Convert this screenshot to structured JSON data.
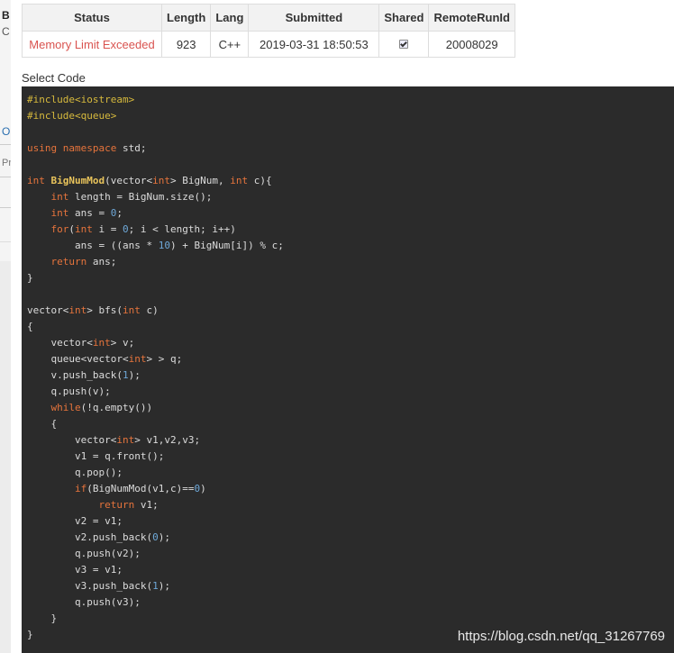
{
  "sidebar_fragments": [
    "B",
    "C",
    "O",
    "Pr"
  ],
  "table": {
    "headers": [
      "Status",
      "Length",
      "Lang",
      "Submitted",
      "Shared",
      "RemoteRunId"
    ],
    "row": {
      "status": "Memory Limit Exceeded",
      "length": "923",
      "lang": "C++",
      "submitted": "2019-03-31 18:50:53",
      "shared": true,
      "remote_run_id": "20008029"
    }
  },
  "select_code_label": "Select Code",
  "code_lines": [
    "#include<iostream>",
    "#include<queue>",
    "",
    "using namespace std;",
    "",
    "int BigNumMod(vector<int> BigNum, int c){",
    "    int length = BigNum.size();",
    "    int ans = 0;",
    "    for(int i = 0; i < length; i++)",
    "        ans = ((ans * 10) + BigNum[i]) % c;",
    "    return ans;",
    "}",
    "",
    "vector<int> bfs(int c)",
    "{",
    "    vector<int> v;",
    "    queue<vector<int> > q;",
    "    v.push_back(1);",
    "    q.push(v);",
    "    while(!q.empty())",
    "    {",
    "        vector<int> v1,v2,v3;",
    "        v1 = q.front();",
    "        q.pop();",
    "        if(BigNumMod(v1,c)==0)",
    "            return v1;",
    "        v2 = v1;",
    "        v2.push_back(0);",
    "        q.push(v2);",
    "        v3 = v1;",
    "        v3.push_back(1);",
    "        q.push(v3);",
    "    }",
    "}"
  ],
  "watermark": "https://blog.csdn.net/qq_31267769",
  "colors": {
    "code_bg": "#2b2b2b",
    "status_error": "#d9534f",
    "preprocessor": "#d7ba3d",
    "keyword": "#e6743c",
    "function_name": "#e8c35b",
    "number": "#6ea8d8"
  }
}
